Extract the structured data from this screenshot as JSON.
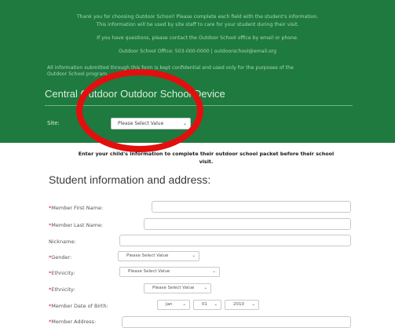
{
  "colors": {
    "banner": "#1f7a3f",
    "annotation_ring": "#e20f0f",
    "required_mark": "#dd1111"
  },
  "banner": {
    "intro_lines": [
      "Thank you for choosing Outdoor School! Please complete each field with the student's information.",
      "This information will be used by site staff to care for your student during their visit.",
      "If you have questions, please contact the Outdoor School office by email or phone.",
      "Outdoor School Office: 503-000-0000 | outdoorschool@email.org",
      "All information submitted through this form is kept confidential and used only for the purposes of the",
      "Outdoor School program."
    ],
    "center_title": "Central Outdoor Outdoor School Device",
    "site_label": "Site:",
    "site_select_value": "Please Select Value"
  },
  "instructions": "Enter your child's information to complete their outdoor school packet before their school visit.",
  "section_title": "Student information and address:",
  "fields": {
    "first_name_label": "Member First Name:",
    "last_name_label": "Member Last Name:",
    "nickname_label": "Nickname:",
    "gender_label": "Gender:",
    "gender_value": "Please Select Value",
    "ethnicity_label": "Ethnicity:",
    "ethnicity_value": "Please Select Value",
    "ethnicity2_label": "Ethnicity:",
    "ethnicity2_value": "Please Select Value",
    "dob_label": "Member Date of Birth:",
    "dob_month": "Jan",
    "dob_day": "01",
    "dob_year": "2010",
    "address_label": "Member Address:"
  },
  "icons": {
    "dropdown": "chevron-down-icon",
    "required": "asterisk"
  }
}
